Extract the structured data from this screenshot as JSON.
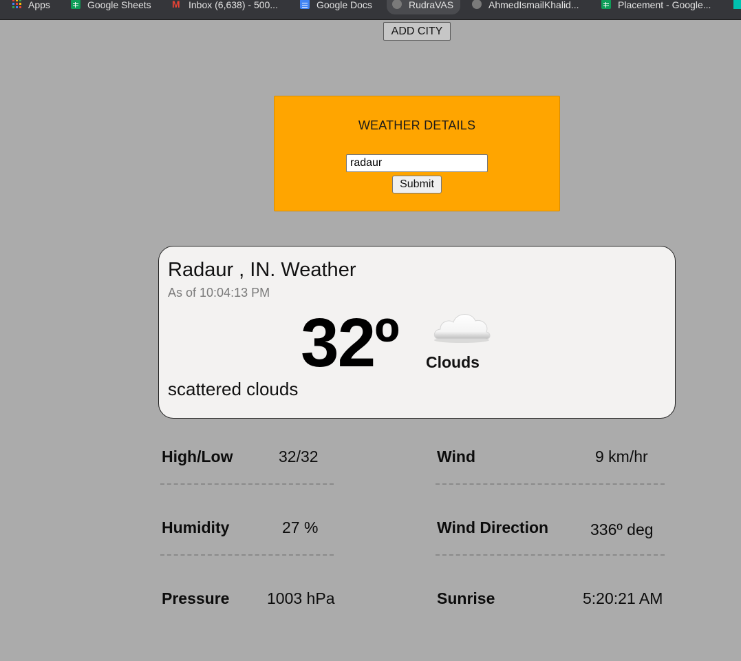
{
  "bookmarks": [
    {
      "label": "Apps",
      "icon": "apps-grid-icon"
    },
    {
      "label": "Google Sheets",
      "icon": "google-sheets-icon"
    },
    {
      "label": "Inbox (6,638) - 500...",
      "icon": "gmail-icon"
    },
    {
      "label": "Google Docs",
      "icon": "google-docs-icon"
    },
    {
      "label": "RudraVAS",
      "icon": "github-icon"
    },
    {
      "label": "AhmedIsmailKhalid...",
      "icon": "github-icon"
    },
    {
      "label": "Placement - Google...",
      "icon": "google-sheets-icon"
    }
  ],
  "header": {
    "add_city_label": "ADD CITY"
  },
  "form": {
    "title": "WEATHER DETAILS",
    "city_value": "radaur",
    "submit_label": "Submit",
    "bg_color": "#ffa500"
  },
  "weather": {
    "location": "Radaur , IN. Weather",
    "as_of": "As of 10:04:13 PM",
    "temperature": "32º",
    "icon": "cloud-icon",
    "condition": "Clouds",
    "description": "scattered clouds"
  },
  "details": [
    {
      "label": "High/Low",
      "value": "32/32"
    },
    {
      "label": "Wind",
      "value": "9 km/hr"
    },
    {
      "label": "Humidity",
      "value": "27 %"
    },
    {
      "label": "Wind Direction",
      "value": "336º deg"
    },
    {
      "label": "Pressure",
      "value": "1003 hPa"
    },
    {
      "label": "Sunrise",
      "value": "5:20:21 AM"
    }
  ]
}
